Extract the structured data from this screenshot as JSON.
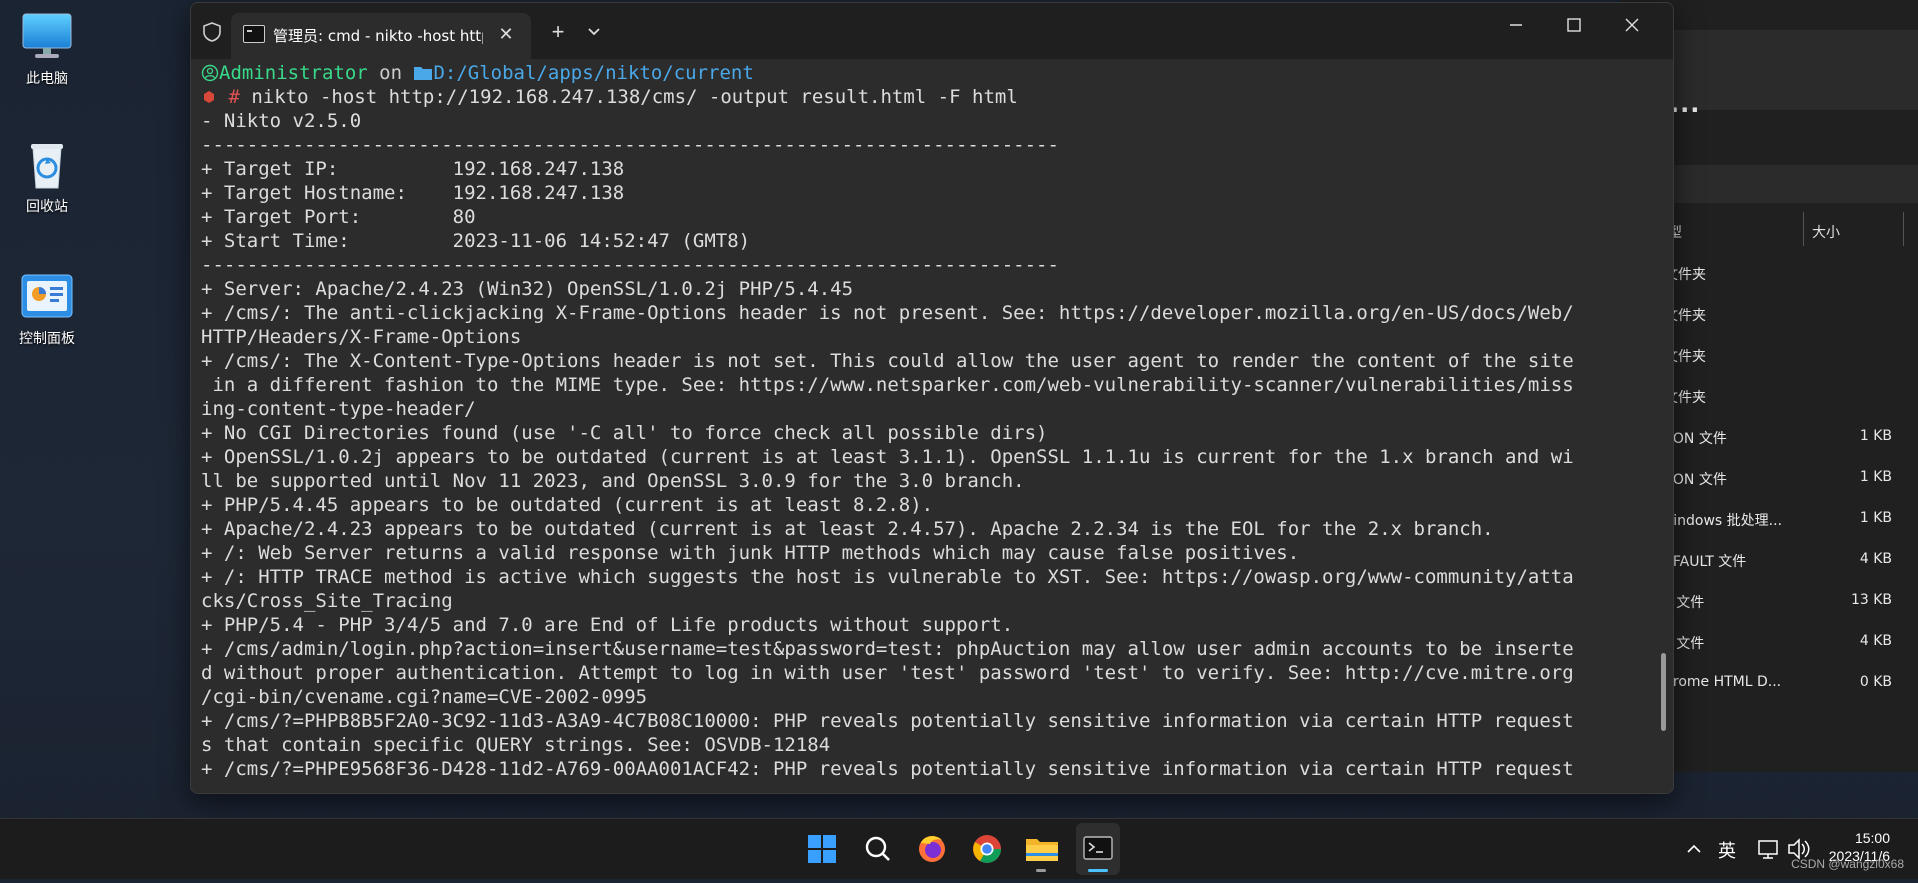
{
  "desktop": {
    "icons": [
      {
        "name": "此电脑"
      },
      {
        "name": "回收站"
      },
      {
        "name": "控制面板"
      }
    ]
  },
  "explorer": {
    "more_label": "···",
    "headers": {
      "type": "型",
      "size": "大小"
    },
    "rows": [
      {
        "type": "文件夹",
        "size": ""
      },
      {
        "type": "文件夹",
        "size": ""
      },
      {
        "type": "文件夹",
        "size": ""
      },
      {
        "type": "文件夹",
        "size": ""
      },
      {
        "type": "SON 文件",
        "size": "1 KB"
      },
      {
        "type": "SON 文件",
        "size": "1 KB"
      },
      {
        "type": "Vindows 批处理...",
        "size": "1 KB"
      },
      {
        "type": "EFAULT 文件",
        "size": "4 KB"
      },
      {
        "type": "L 文件",
        "size": "13 KB"
      },
      {
        "type": "L 文件",
        "size": "4 KB"
      },
      {
        "type": "hrome HTML D...",
        "size": "0 KB"
      }
    ]
  },
  "terminal": {
    "tab_title": "管理员: cmd - nikto  -host http",
    "lines": [
      "- Nikto v2.5.0",
      "---------------------------------------------------------------------------",
      "+ Target IP:          192.168.247.138",
      "+ Target Hostname:    192.168.247.138",
      "+ Target Port:        80",
      "+ Start Time:         2023-11-06 14:52:47 (GMT8)",
      "---------------------------------------------------------------------------",
      "+ Server: Apache/2.4.23 (Win32) OpenSSL/1.0.2j PHP/5.4.45",
      "+ /cms/: The anti-clickjacking X-Frame-Options header is not present. See: https://developer.mozilla.org/en-US/docs/Web/",
      "HTTP/Headers/X-Frame-Options",
      "+ /cms/: The X-Content-Type-Options header is not set. This could allow the user agent to render the content of the site",
      " in a different fashion to the MIME type. See: https://www.netsparker.com/web-vulnerability-scanner/vulnerabilities/miss",
      "ing-content-type-header/",
      "+ No CGI Directories found (use '-C all' to force check all possible dirs)",
      "+ OpenSSL/1.0.2j appears to be outdated (current is at least 3.1.1). OpenSSL 1.1.1u is current for the 1.x branch and wi",
      "ll be supported until Nov 11 2023, and OpenSSL 3.0.9 for the 3.0 branch.",
      "+ PHP/5.4.45 appears to be outdated (current is at least 8.2.8).",
      "+ Apache/2.4.23 appears to be outdated (current is at least 2.4.57). Apache 2.2.34 is the EOL for the 2.x branch.",
      "+ /: Web Server returns a valid response with junk HTTP methods which may cause false positives.",
      "+ /: HTTP TRACE method is active which suggests the host is vulnerable to XST. See: https://owasp.org/www-community/atta",
      "cks/Cross_Site_Tracing",
      "+ PHP/5.4 - PHP 3/4/5 and 7.0 are End of Life products without support.",
      "+ /cms/admin/login.php?action=insert&username=test&password=test: phpAuction may allow user admin accounts to be inserte",
      "d without proper authentication. Attempt to log in with user 'test' password 'test' to verify. See: http://cve.mitre.org",
      "/cgi-bin/cvename.cgi?name=CVE-2002-0995",
      "+ /cms/?=PHPB8B5F2A0-3C92-11d3-A3A9-4C7B08C10000: PHP reveals potentially sensitive information via certain HTTP request",
      "s that contain specific QUERY strings. See: OSVDB-12184",
      "+ /cms/?=PHPE9568F36-D428-11d2-A769-00AA001ACF42: PHP reveals potentially sensitive information via certain HTTP request"
    ],
    "prompt": {
      "user": "Administrator",
      "on": " on ",
      "path": "D:/Global/apps/nikto/current",
      "hash": "#",
      "command": " nikto -host http://192.168.247.138/cms/ -output result.html -F html"
    }
  },
  "taskbar": {
    "ime": "英",
    "time": "15:00",
    "date": "2023/11/6",
    "watermark": "CSDN @wangzl0x68"
  }
}
